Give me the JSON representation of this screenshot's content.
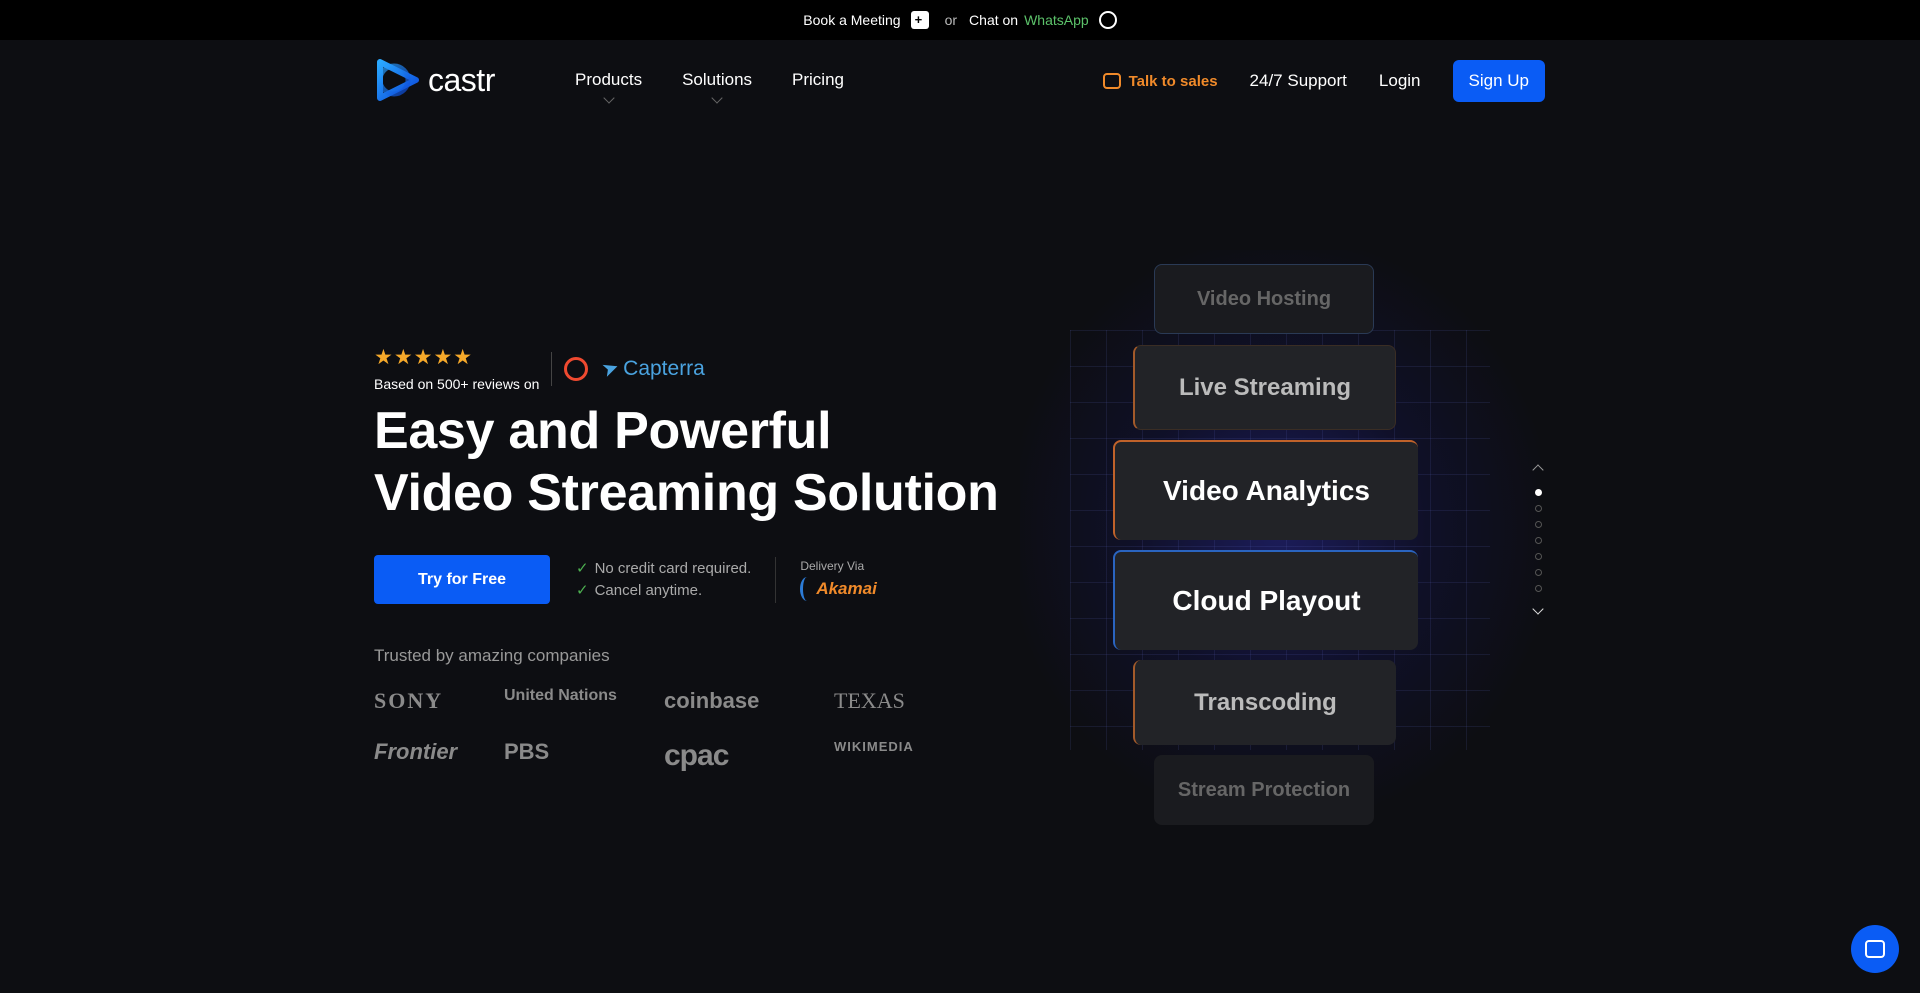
{
  "topbar": {
    "book_label": "Book a Meeting",
    "or_label": "or",
    "chat_label": "Chat on",
    "whatsapp_label": "WhatsApp"
  },
  "brand": {
    "name": "castr"
  },
  "nav": {
    "links": [
      {
        "label": "Products"
      },
      {
        "label": "Solutions"
      },
      {
        "label": "Pricing"
      }
    ],
    "talk_to_sales": "Talk to sales",
    "support": "24/7 Support",
    "login": "Login",
    "signup": "Sign Up"
  },
  "hero": {
    "reviews_text": "Based on 500+ reviews on",
    "rating_stars": 5,
    "review_sites": [
      "G2",
      "Capterra"
    ],
    "capterra_label": "Capterra",
    "headline_line1": "Easy and Powerful",
    "headline_line2": "Video Streaming Solution",
    "cta_label": "Try for Free",
    "check1": "No credit card required.",
    "check2": "Cancel anytime.",
    "delivery_via": "Delivery Via",
    "delivery_brand": "Akamai",
    "trusted_label": "Trusted by amazing companies",
    "companies": [
      "SONY",
      "United Nations",
      "coinbase",
      "TEXAS",
      "Frontier",
      "PBS",
      "cpac",
      "WIKIMEDIA"
    ]
  },
  "features": [
    {
      "label": "Video Hosting"
    },
    {
      "label": "Live Streaming"
    },
    {
      "label": "Video Analytics"
    },
    {
      "label": "Cloud Playout"
    },
    {
      "label": "Transcoding"
    },
    {
      "label": "Stream Protection"
    }
  ],
  "pager": {
    "count": 7,
    "active_index": 0
  },
  "colors": {
    "accent": "#0a5cf5",
    "sales": "#f08a2a",
    "whatsapp": "#5cc26a",
    "stars": "#f6a92a"
  }
}
